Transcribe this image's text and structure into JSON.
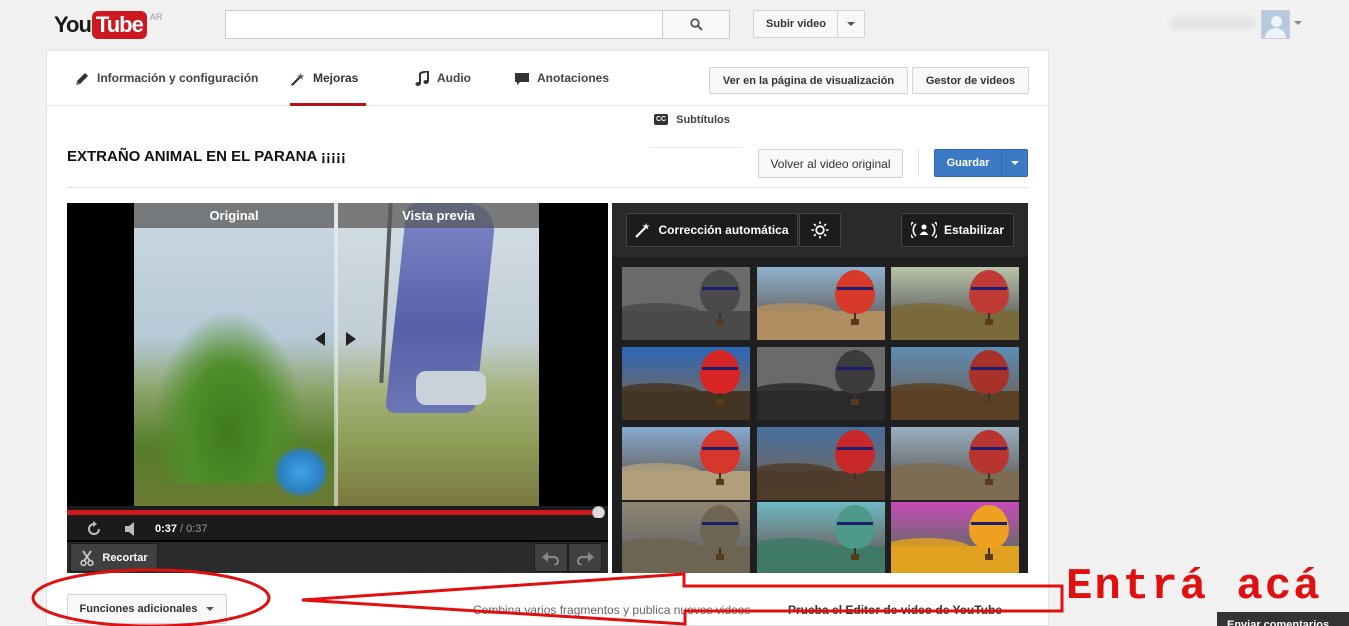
{
  "masthead": {
    "logo_you": "You",
    "logo_tube": "Tube",
    "region": "AR",
    "search_placeholder": "",
    "upload_label": "Subir video"
  },
  "tabs": [
    {
      "label": "Información y configuración",
      "icon": "pencil-icon"
    },
    {
      "label": "Mejoras",
      "icon": "magic-wand-icon",
      "active": true
    },
    {
      "label": "Audio",
      "icon": "music-note-icon"
    },
    {
      "label": "Anotaciones",
      "icon": "speech-bubble-icon"
    }
  ],
  "header_buttons": {
    "watch_page": "Ver en la página de visualización",
    "video_manager": "Gestor de videos"
  },
  "subtitles_tab": {
    "badge": "CC",
    "label": "Subtítulos"
  },
  "video": {
    "title": "EXTRAÑO ANIMAL EN EL PARANA ¡¡¡¡¡",
    "revert_label": "Volver al video original",
    "save_label": "Guardar"
  },
  "player": {
    "label_original": "Original",
    "label_preview": "Vista previa",
    "time_current": "0:37",
    "time_separator": "/",
    "time_total": "0:37",
    "progress": 1.0,
    "trim_label": "Recortar"
  },
  "enhance": {
    "auto_fix_label": "Corrección automática",
    "stabilize_label": "Estabilizar",
    "filters": [
      {
        "sky": "#6b6b6b",
        "land": "#4a4a4a",
        "balloon": "#4a4a4a"
      },
      {
        "sky": "#8fb3d1",
        "land": "#b08e62",
        "balloon": "#d83a2a"
      },
      {
        "sky": "#b8c4a8",
        "land": "#7a6a3a",
        "balloon": "#c03a36"
      },
      {
        "sky": "#2c66b8",
        "land": "#433524",
        "balloon": "#d92424"
      },
      {
        "sky": "#6a6a6a",
        "land": "#2a2a2a",
        "balloon": "#3c3c3c"
      },
      {
        "sky": "#5d8db3",
        "land": "#5a4024",
        "balloon": "#a8312a"
      },
      {
        "sky": "#86a9cf",
        "land": "#b2a07d",
        "balloon": "#d8362c"
      },
      {
        "sky": "#466e9f",
        "land": "#4e3b2a",
        "balloon": "#c82828"
      },
      {
        "sky": "#9aafc2",
        "land": "#7d6b52",
        "balloon": "#b83430"
      },
      {
        "sky": "#8e8670",
        "land": "#6e6452",
        "balloon": "#6e6652"
      },
      {
        "sky": "#6fb9c2",
        "land": "#3e7a66",
        "balloon": "#4e9a8a"
      },
      {
        "sky": "#c44bb7",
        "land": "#e0a020",
        "balloon": "#f0a020"
      }
    ]
  },
  "footer": {
    "extra_label": "Funciones adicionales",
    "combine_text": "Combina varios fragmentos y publica nuevos videos",
    "try_editor_text": "Prueba el Editor de video de YouTube",
    "feedback_label": "Enviar comentarios"
  },
  "annotation": {
    "text": "Entrá acá",
    "color": "#e01010"
  }
}
